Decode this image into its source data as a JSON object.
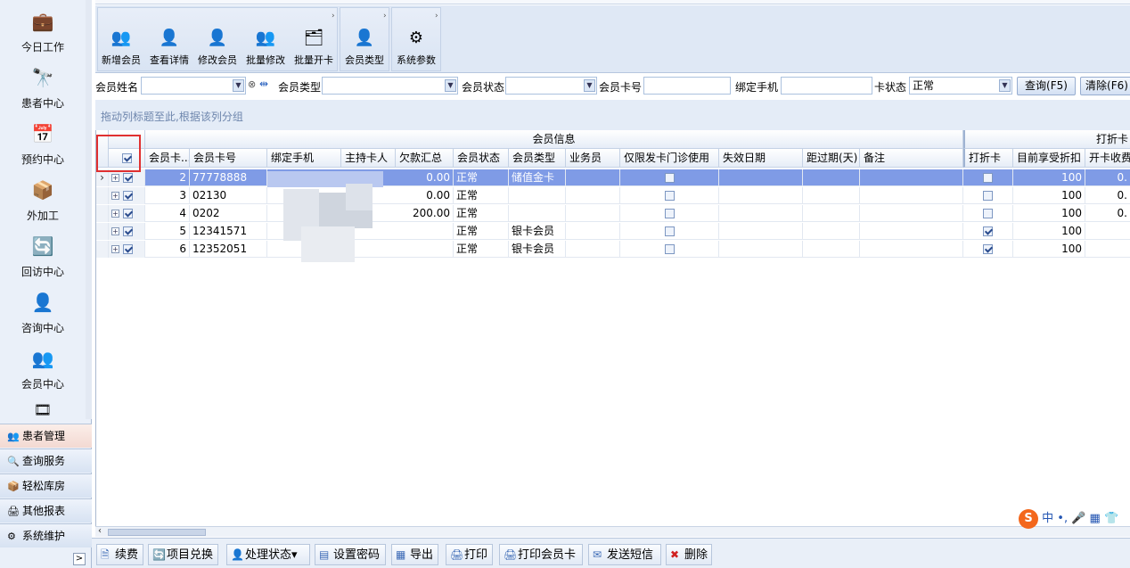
{
  "sidebar": {
    "items": [
      {
        "label": "今日工作",
        "icon": "briefcase-icon",
        "glyph": "💼"
      },
      {
        "label": "患者中心",
        "icon": "binoculars-icon",
        "glyph": "🔭"
      },
      {
        "label": "预约中心",
        "icon": "calendar-icon",
        "glyph": "📅"
      },
      {
        "label": "外加工",
        "icon": "cubes-icon",
        "glyph": "📦"
      },
      {
        "label": "回访中心",
        "icon": "refresh-icon",
        "glyph": "🔄"
      },
      {
        "label": "咨询中心",
        "icon": "consultant-icon",
        "glyph": "👤"
      },
      {
        "label": "会员中心",
        "icon": "members-icon",
        "glyph": "👥"
      }
    ],
    "nav": [
      {
        "label": "患者管理",
        "glyph": "👥"
      },
      {
        "label": "查询服务",
        "glyph": "🔍"
      },
      {
        "label": "轻松库房",
        "glyph": "📦"
      },
      {
        "label": "其他报表",
        "glyph": "🖨"
      },
      {
        "label": "系统维护",
        "glyph": "⚙"
      }
    ],
    "expand_glyph": ">"
  },
  "ribbon": {
    "buttons": [
      {
        "label": "新增会员",
        "glyph": "👥"
      },
      {
        "label": "查看详情",
        "glyph": "👤"
      },
      {
        "label": "修改会员",
        "glyph": "👤"
      },
      {
        "label": "批量修改",
        "glyph": "👥"
      },
      {
        "label": "批量开卡",
        "glyph": "🗂"
      },
      {
        "label": "会员类型",
        "glyph": "👤"
      },
      {
        "label": "系统参数",
        "glyph": "⚙"
      }
    ]
  },
  "filters": {
    "name_label": "会员姓名",
    "type_label": "会员类型",
    "status_label": "会员状态",
    "card_label": "会员卡号",
    "phone_label": "绑定手机",
    "cardstatus_label": "卡状态",
    "cardstatus_value": "正常",
    "query_button": "查询(F5)",
    "clear_button": "清除(F6)"
  },
  "group_panel_text": "拖动列标题至此,根据该列分组",
  "grid": {
    "band_member": "会员信息",
    "band_discount": "打折卡",
    "headers": [
      "会员卡...",
      "会员卡号",
      "绑定手机",
      "主持卡人",
      "欠款汇总",
      "会员状态",
      "会员类型",
      "业务员",
      "仅限发卡门诊使用",
      "失效日期",
      "距过期(天)",
      "备注",
      "打折卡",
      "目前享受折扣",
      "开卡收费"
    ],
    "rows": [
      {
        "idx": "2",
        "card": "77778888",
        "debt": "0.00",
        "status": "正常",
        "type": "储值金卡",
        "onlyclinic": false,
        "discountcard": false,
        "discount": "100",
        "fee": "0.",
        "selected": true
      },
      {
        "idx": "3",
        "card": "02130",
        "debt": "0.00",
        "status": "正常",
        "type": "",
        "onlyclinic": false,
        "discountcard": false,
        "discount": "100",
        "fee": "0.",
        "selected": false
      },
      {
        "idx": "4",
        "card": "0202",
        "debt": "200.00",
        "status": "正常",
        "type": "",
        "onlyclinic": false,
        "discountcard": false,
        "discount": "100",
        "fee": "0.",
        "selected": false
      },
      {
        "idx": "5",
        "card": "12341571",
        "debt": "",
        "status": "正常",
        "type": "银卡会员",
        "onlyclinic": false,
        "discountcard": true,
        "discount": "100",
        "fee": "",
        "selected": false
      },
      {
        "idx": "6",
        "card": "12352051",
        "debt": "",
        "status": "正常",
        "type": "银卡会员",
        "onlyclinic": false,
        "discountcard": true,
        "discount": "100",
        "fee": "",
        "selected": false
      }
    ]
  },
  "bottom": {
    "buttons": [
      {
        "label": "续费",
        "glyph": "🗎"
      },
      {
        "label": "项目兑换",
        "glyph": "🔄"
      },
      {
        "label": "处理状态",
        "glyph": "👤",
        "dropdown": "▾"
      },
      {
        "label": "设置密码",
        "glyph": "▤"
      },
      {
        "label": "导出",
        "glyph": "▦"
      },
      {
        "label": "打印",
        "glyph": "🖨"
      },
      {
        "label": "打印会员卡",
        "glyph": "🖨"
      },
      {
        "label": "发送短信",
        "glyph": "✉"
      },
      {
        "label": "删除",
        "glyph": "✖"
      }
    ]
  },
  "ime": {
    "logo": "S",
    "text": "中 •, 🎤 ▦ 👕"
  }
}
